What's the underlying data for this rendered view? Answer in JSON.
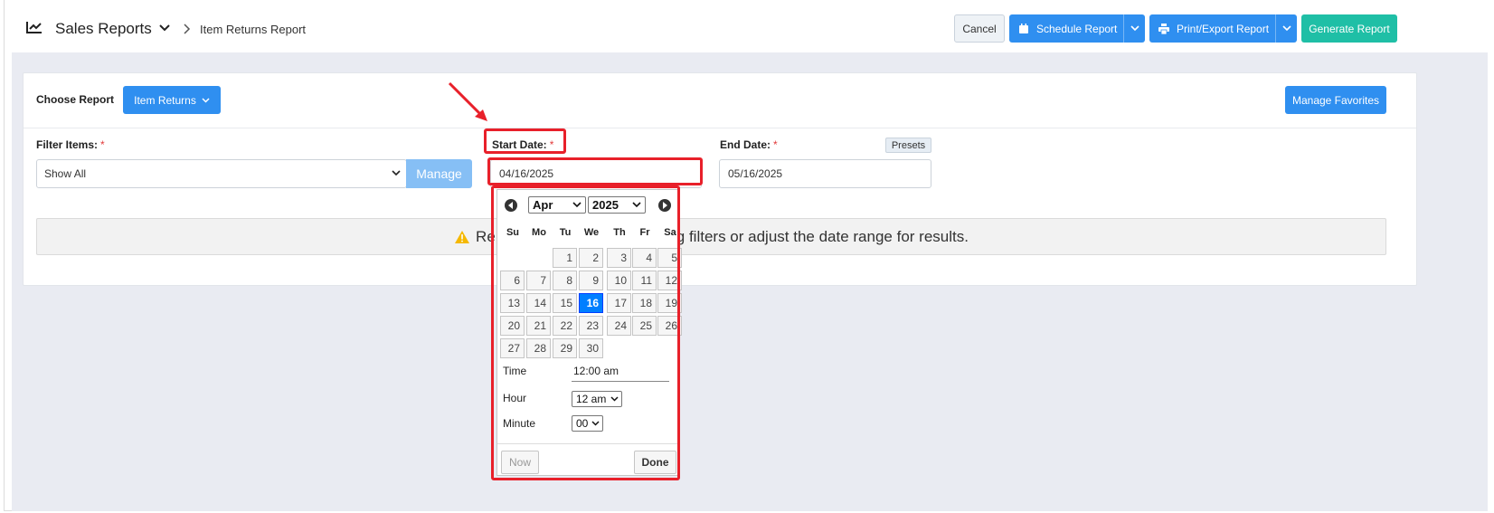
{
  "header": {
    "app_title": "Sales Reports",
    "breadcrumb": "Item Returns Report",
    "cancel_label": "Cancel",
    "schedule_label": "Schedule Report",
    "print_label": "Print/Export Report",
    "generate_label": "Generate Report"
  },
  "card": {
    "choose_label": "Choose Report",
    "report_button": "Item Returns",
    "favorites_button": "Manage Favorites"
  },
  "filters": {
    "filter_items_label": "Filter Items:",
    "filter_items_value": "Show All",
    "manage_label": "Manage",
    "start_label": "Start Date:",
    "start_value": "04/16/2025",
    "end_label": "End Date:",
    "end_value": "05/16/2025",
    "presets_label": "Presets",
    "required_mark": "*"
  },
  "notice": {
    "text_left": "Re",
    "text_right": "g filters or adjust the date range for results."
  },
  "datepicker": {
    "month": "Apr",
    "year": "2025",
    "weekdays": [
      "Su",
      "Mo",
      "Tu",
      "We",
      "Th",
      "Fr",
      "Sa"
    ],
    "first_weekday_index": 2,
    "days_in_month": 30,
    "selected_day": 16,
    "time_label": "Time",
    "time_value": "12:00 am",
    "hour_label": "Hour",
    "hour_value": "12 am",
    "minute_label": "Minute",
    "minute_value": "00",
    "now_label": "Now",
    "done_label": "Done"
  },
  "colors": {
    "primary": "#2f8ff0",
    "generate": "#1fbfa6",
    "highlight": "#e8202a",
    "selected_day": "#007fff"
  }
}
